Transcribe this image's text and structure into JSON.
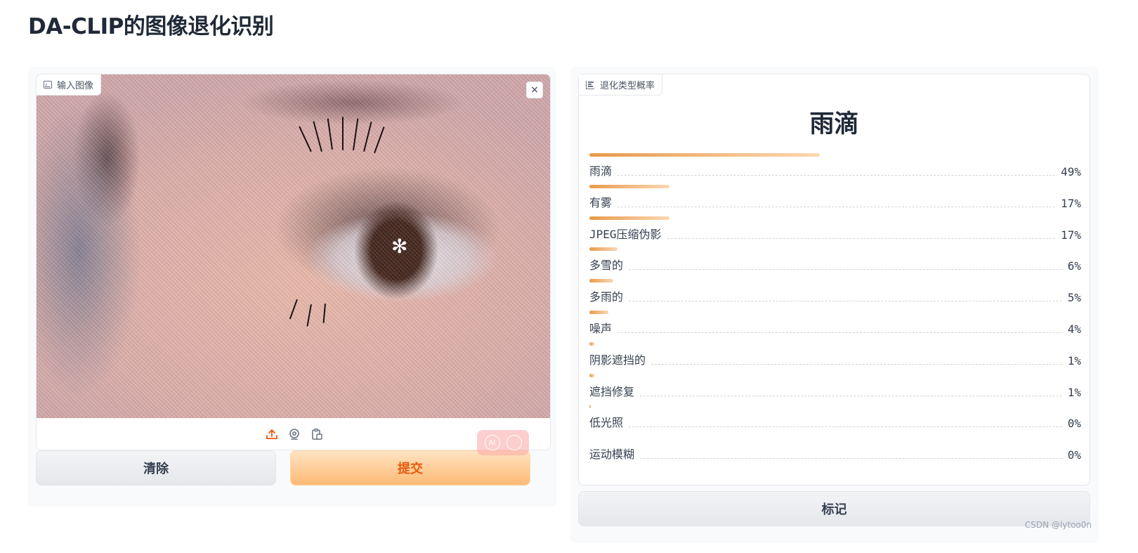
{
  "app": {
    "title": "DA-CLIP的图像退化识别"
  },
  "input": {
    "label": "输入图像",
    "close_label": "×",
    "sources": [
      {
        "name": "upload-icon",
        "active": true
      },
      {
        "name": "webcam-icon",
        "active": false
      },
      {
        "name": "clipboard-icon",
        "active": false
      }
    ],
    "clear_label": "清除",
    "submit_label": "提交"
  },
  "output": {
    "label": "退化类型概率",
    "top_label": "雨滴",
    "confidences": [
      {
        "name": "雨滴",
        "value": 0.49,
        "display": "49%"
      },
      {
        "name": "有雾",
        "value": 0.17,
        "display": "17%"
      },
      {
        "name": "JPEG压缩伪影",
        "value": 0.17,
        "display": "17%"
      },
      {
        "name": "多雪的",
        "value": 0.06,
        "display": "6%"
      },
      {
        "name": "多雨的",
        "value": 0.05,
        "display": "5%"
      },
      {
        "name": "噪声",
        "value": 0.04,
        "display": "4%"
      },
      {
        "name": "阴影遮挡的",
        "value": 0.01,
        "display": "1%"
      },
      {
        "name": "遮挡修复",
        "value": 0.01,
        "display": "1%"
      },
      {
        "name": "低光照",
        "value": 0.0,
        "display": "0%"
      },
      {
        "name": "运动模糊",
        "value": 0.0,
        "display": "0%"
      }
    ],
    "flag_label": "标记"
  },
  "watermark": "CSDN @lytoo0n",
  "colors": {
    "accent": "#ea580c",
    "bar_start": "#e89a4c",
    "bar_end": "#fcd7b0"
  }
}
